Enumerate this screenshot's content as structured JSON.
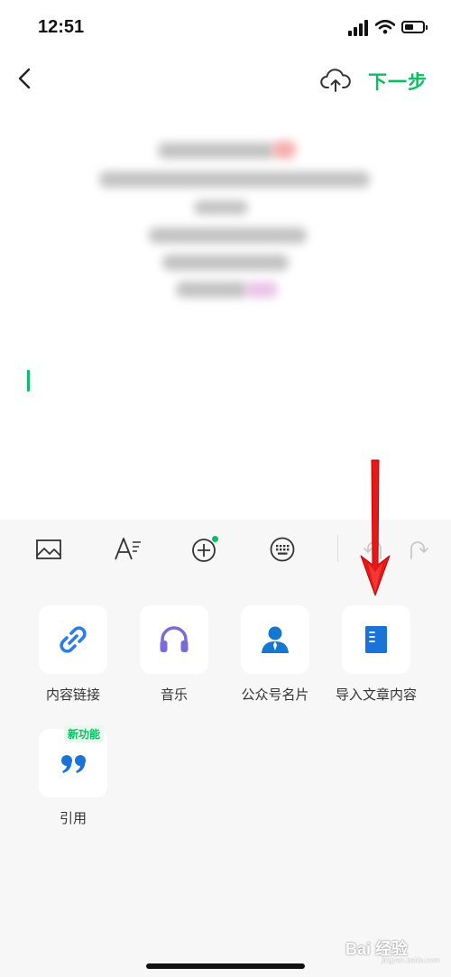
{
  "status": {
    "time": "12:51"
  },
  "nav": {
    "next_label": "下一步"
  },
  "toolbar": {
    "buttons": [
      "image-icon",
      "text-format-icon",
      "add-circle-icon",
      "keyboard-icon",
      "undo-icon",
      "redo-icon"
    ],
    "add_dot_color": "#07c160"
  },
  "tiles": [
    {
      "label": "内容链接",
      "icon": "link-icon"
    },
    {
      "label": "音乐",
      "icon": "headphones-icon"
    },
    {
      "label": "公众号名片",
      "icon": "profile-icon"
    },
    {
      "label": "导入文章内容",
      "icon": "document-icon"
    },
    {
      "label": "引用",
      "icon": "quote-icon",
      "badge": "新功能"
    }
  ],
  "colors": {
    "accent": "#07c160",
    "link": "#2b7de9",
    "music": "#7a6bd6",
    "profile": "#1677d2",
    "document": "#1a73d9",
    "arrow": "#e21a1a"
  },
  "watermark": {
    "brand": "Bai 经验",
    "domain": "jingyan.baidu.com"
  }
}
